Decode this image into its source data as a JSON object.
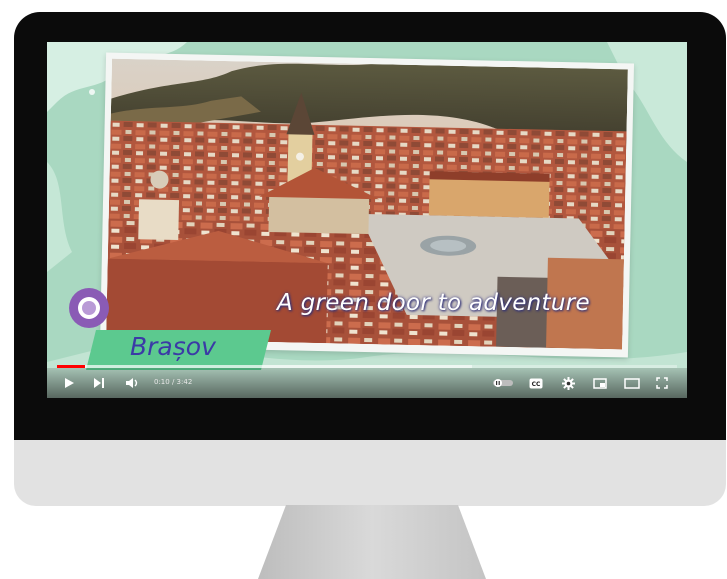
{
  "video": {
    "tagline": "A green door to adventure",
    "city": "Brașov",
    "time_current": "0:10",
    "time_separator": " / ",
    "time_total": "3:42",
    "progress_played": 0.045,
    "progress_buffered": 0.67
  },
  "controls": {
    "icons": [
      "play-icon",
      "next-icon",
      "volume-icon",
      "autoplay-toggle-icon",
      "captions-icon",
      "settings-gear-icon",
      "miniplayer-icon",
      "theater-mode-icon",
      "fullscreen-icon"
    ],
    "cc_label": "CC"
  },
  "colors": {
    "bezel": "#0b0b0b",
    "chin": "#e2e2e2",
    "screen_background": "#a9d8c1",
    "city_tag": "#5cc98f",
    "city_text": "#3b3aa6",
    "pin": "#8a5bb5",
    "progress": "#ff0000"
  }
}
